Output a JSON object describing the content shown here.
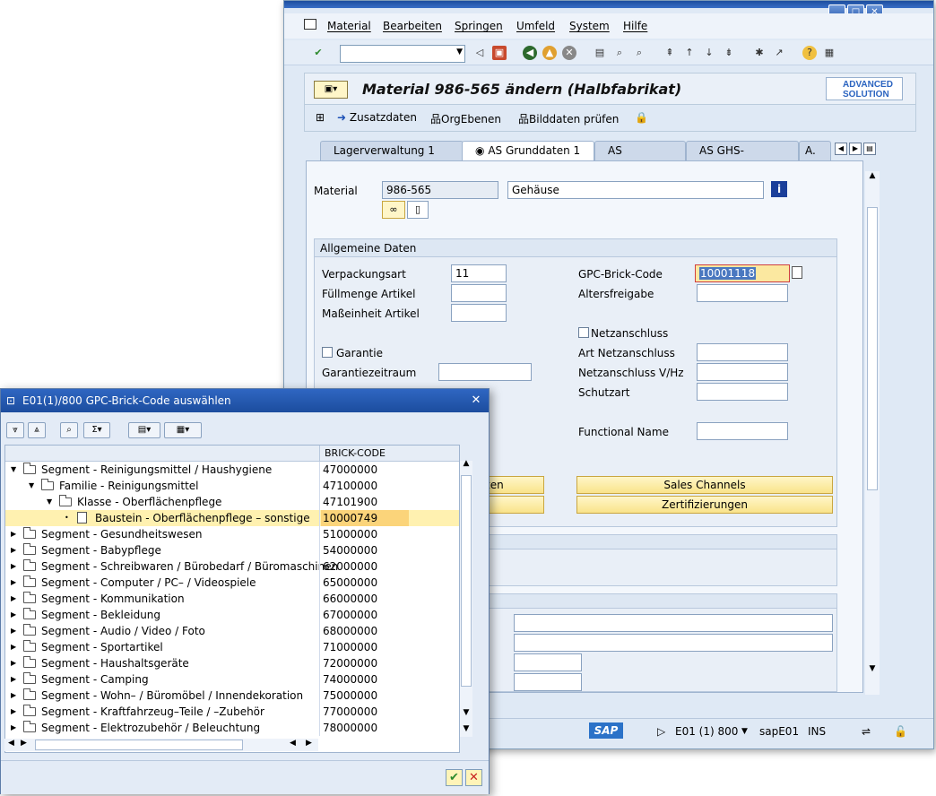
{
  "main": {
    "menu": [
      "Material",
      "Bearbeiten",
      "Springen",
      "Umfeld",
      "System",
      "Hilfe"
    ],
    "title": "Material 986-565 ändern (Halbfabrikat)",
    "logo": [
      "ADVANCED",
      "SOLUTION"
    ],
    "appbar": [
      "Zusatzdaten",
      "OrgEbenen",
      "Bilddaten prüfen"
    ],
    "tabs": [
      "Lagerverwaltung 1",
      "AS Grunddaten 1",
      "AS Gefahrgut",
      "AS GHS-Angaben",
      "A."
    ],
    "material_label": "Material",
    "material_value": "986-565",
    "material_desc": "Gehäuse",
    "group_title": "Allgemeine Daten",
    "fields": {
      "verpackungsart": "Verpackungsart",
      "verpackungsart_val": "11",
      "fuellmenge": "Füllmenge Artikel",
      "masseinheit": "Maßeinheit Artikel",
      "garantie": "Garantie",
      "garantiezeitraum": "Garantiezeitraum",
      "gpc": "GPC-Brick-Code",
      "gpc_val": "10001118",
      "altersfreigabe": "Altersfreigabe",
      "netzanschluss": "Netzanschluss",
      "art_netzanschluss": "Art Netzanschluss",
      "netzanschluss_v": "Netzanschluss V/Hz",
      "schutzart": "Schutzart",
      "functional_name": "Functional Name"
    },
    "buttons": {
      "left1": "ten",
      "sales": "Sales Channels",
      "zert": "Zertifizierungen"
    },
    "status": {
      "sap": "SAP",
      "system": "E01 (1) 800",
      "server": "sapE01",
      "mode": "INS"
    }
  },
  "popup": {
    "title": "E01(1)/800 GPC-Brick-Code auswählen",
    "col_header": "BRICK-CODE",
    "rows": [
      {
        "name": "Segment - Reinigungsmittel / Haushygiene",
        "code": "47000000"
      },
      {
        "name": "Familie - Reinigungsmittel",
        "code": "47100000"
      },
      {
        "name": "Klasse - Oberflächenpflege",
        "code": "47101900"
      },
      {
        "name": "Baustein - Oberflächenpflege – sonstige",
        "code": "10000749"
      },
      {
        "name": "Segment - Gesundheitswesen",
        "code": "51000000"
      },
      {
        "name": "Segment - Babypflege",
        "code": "54000000"
      },
      {
        "name": "Segment - Schreibwaren / Bürobedarf / Büromaschinen",
        "code": "62000000"
      },
      {
        "name": "Segment - Computer / PC– / Videospiele",
        "code": "65000000"
      },
      {
        "name": "Segment - Kommunikation",
        "code": "66000000"
      },
      {
        "name": "Segment - Bekleidung",
        "code": "67000000"
      },
      {
        "name": "Segment - Audio / Video / Foto",
        "code": "68000000"
      },
      {
        "name": "Segment - Sportartikel",
        "code": "71000000"
      },
      {
        "name": "Segment - Haushaltsgeräte",
        "code": "72000000"
      },
      {
        "name": "Segment - Camping",
        "code": "74000000"
      },
      {
        "name": "Segment - Wohn– / Büromöbel / Innendekoration",
        "code": "75000000"
      },
      {
        "name": "Segment - Kraftfahrzeug–Teile / –Zubehör",
        "code": "77000000"
      },
      {
        "name": "Segment - Elektrozubehör / Beleuchtung",
        "code": "78000000"
      }
    ]
  }
}
